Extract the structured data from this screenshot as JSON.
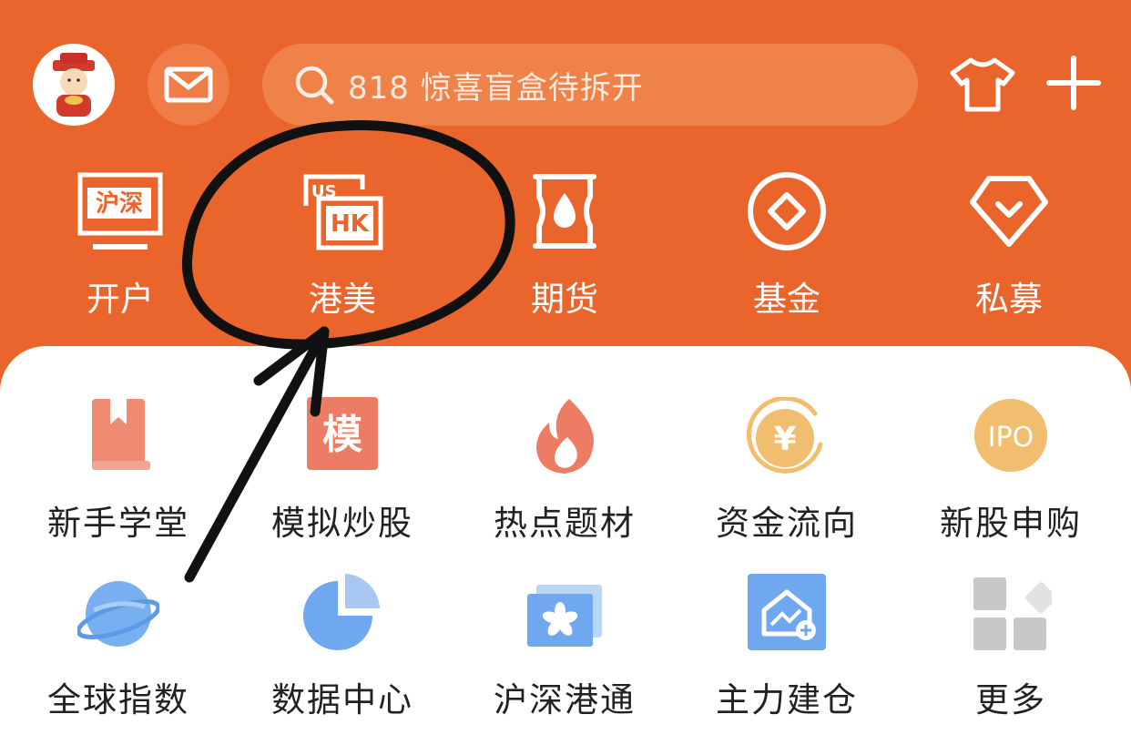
{
  "header": {
    "avatar_icon": "fortune-god-avatar",
    "mail_icon": "mail-icon",
    "search": {
      "placeholder": "818 惊喜盲盒待拆开",
      "icon": "search-icon"
    },
    "skin_icon": "shirt-icon",
    "add_icon": "plus-icon"
  },
  "top_nav": [
    {
      "label": "开户",
      "icon": "open-account-icon",
      "badge": "沪深"
    },
    {
      "label": "港美",
      "icon": "hk-us-icon",
      "badge": "HK",
      "badge_back": "US"
    },
    {
      "label": "期货",
      "icon": "futures-icon"
    },
    {
      "label": "基金",
      "icon": "fund-icon"
    },
    {
      "label": "私募",
      "icon": "private-fund-icon"
    }
  ],
  "grid": [
    {
      "label": "新手学堂",
      "icon": "book-icon"
    },
    {
      "label": "模拟炒股",
      "icon": "simulate-icon",
      "badge": "模"
    },
    {
      "label": "热点题材",
      "icon": "fire-icon"
    },
    {
      "label": "资金流向",
      "icon": "yen-coin-icon",
      "badge": "¥"
    },
    {
      "label": "新股申购",
      "icon": "ipo-icon",
      "badge": "IPO"
    },
    {
      "label": "全球指数",
      "icon": "planet-icon"
    },
    {
      "label": "数据中心",
      "icon": "pie-chart-icon"
    },
    {
      "label": "沪深港通",
      "icon": "bauhinia-flag-icon"
    },
    {
      "label": "主力建仓",
      "icon": "house-chart-icon"
    },
    {
      "label": "更多",
      "icon": "more-grid-icon"
    }
  ],
  "colors": {
    "brand": "#e9652c",
    "search_bg": "#ee8248",
    "text_dark": "#222222"
  },
  "annotation": {
    "type": "hand-drawn circle and arrow",
    "target": "港美"
  }
}
